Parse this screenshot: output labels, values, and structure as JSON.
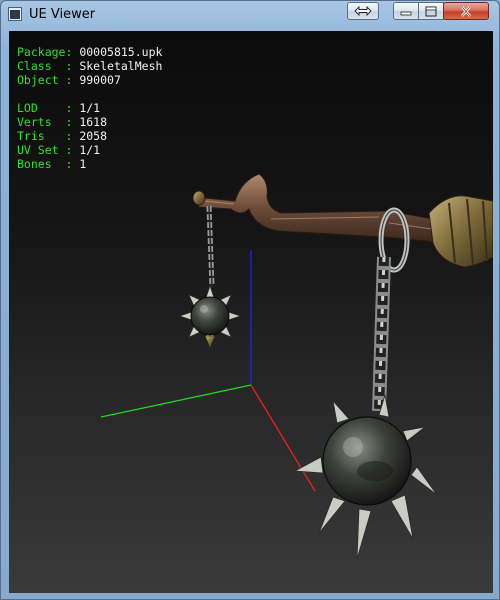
{
  "window": {
    "title": "UE Viewer",
    "buttons": [
      "swap",
      "minimize",
      "maximize",
      "close"
    ]
  },
  "info": {
    "group1": [
      {
        "label": "Package:",
        "value": "00005815.upk"
      },
      {
        "label": "Class  :",
        "value": "SkeletalMesh"
      },
      {
        "label": "Object :",
        "value": "990007"
      }
    ],
    "group2": [
      {
        "label": "LOD    :",
        "value": "1/1"
      },
      {
        "label": "Verts  :",
        "value": "1618"
      },
      {
        "label": "Tris   :",
        "value": "2058"
      },
      {
        "label": "UV Set :",
        "value": "1/1"
      },
      {
        "label": "Bones  :",
        "value": "1"
      }
    ]
  },
  "colors": {
    "label": "#2ee02e",
    "value": "#f2f2f2",
    "axis_x": "#ff2020",
    "axis_y": "#20dd20",
    "axis_z": "#2020ff"
  },
  "scene": {
    "object": "flail-mesh"
  }
}
